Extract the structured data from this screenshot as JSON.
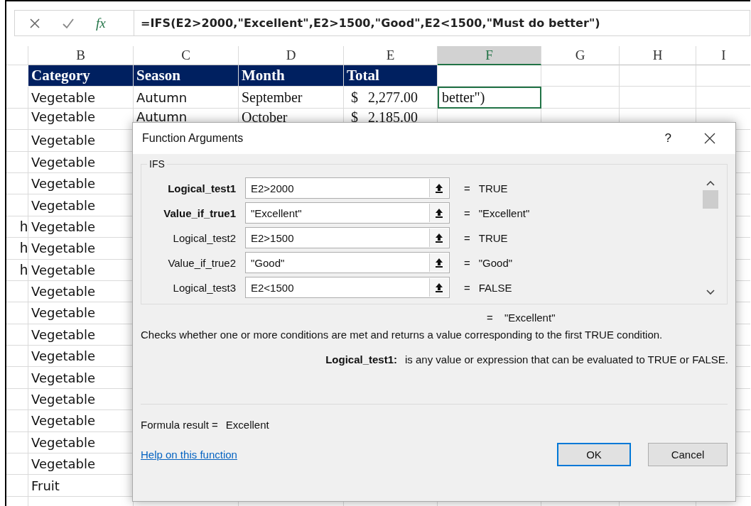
{
  "formula_bar": {
    "function_label": "fx",
    "formula": "=IFS(E2>2000,\"Excellent\",E2>1500,\"Good\",E2<1500,\"Must do better\")"
  },
  "columns": [
    {
      "label": "B",
      "selected": false
    },
    {
      "label": "C",
      "selected": false
    },
    {
      "label": "D",
      "selected": false
    },
    {
      "label": "E",
      "selected": false
    },
    {
      "label": "F",
      "selected": true
    },
    {
      "label": "G",
      "selected": false
    },
    {
      "label": "H",
      "selected": false
    },
    {
      "label": "I",
      "selected": false
    }
  ],
  "header_row": [
    "Category",
    "Season",
    "Month",
    "Total"
  ],
  "rows": [
    {
      "category": "Vegetable",
      "season": "Autumn",
      "month": "September",
      "currency": "$",
      "total": "2,277.00",
      "column_f": {
        "text": "better\")",
        "selected": true
      }
    },
    {
      "category": "Vegetable",
      "season": "Autumn",
      "month": "October",
      "currency": "$",
      "total": "2,185.00"
    },
    {
      "category": "Vegetable"
    },
    {
      "category": "Vegetable"
    },
    {
      "category": "Vegetable"
    },
    {
      "category": "Vegetable"
    },
    {
      "column_a": "h",
      "category": "Vegetable"
    },
    {
      "column_a": "h",
      "category": "Vegetable"
    },
    {
      "column_a": "h",
      "category": "Vegetable"
    },
    {
      "category": "Vegetable"
    },
    {
      "category": "Vegetable"
    },
    {
      "category": "Vegetable"
    },
    {
      "category": "Vegetable"
    },
    {
      "category": "Vegetable"
    },
    {
      "category": "Vegetable"
    },
    {
      "category": "Vegetable"
    },
    {
      "category": "Vegetable"
    },
    {
      "category": "Vegetable"
    },
    {
      "category": "Fruit"
    }
  ],
  "dialog": {
    "title": "Function Arguments",
    "help": "?",
    "function_name": "IFS",
    "arguments": [
      {
        "label": "Logical_test1",
        "bold": true,
        "value": "E2>2000",
        "equals": "=",
        "result": "TRUE"
      },
      {
        "label": "Value_if_true1",
        "bold": true,
        "value": "\"Excellent\"",
        "equals": "=",
        "result": "\"Excellent\""
      },
      {
        "label": "Logical_test2",
        "bold": false,
        "value": "E2>1500",
        "equals": "=",
        "result": "TRUE"
      },
      {
        "label": "Value_if_true2",
        "bold": false,
        "value": "\"Good\"",
        "equals": "=",
        "result": "\"Good\""
      },
      {
        "label": "Logical_test3",
        "bold": false,
        "value": "E2<1500",
        "equals": "=",
        "result": "FALSE"
      }
    ],
    "overall_equals": "=",
    "overall_result": "\"Excellent\"",
    "description": "Checks whether one or more conditions are met and returns a value corresponding to the first TRUE condition.",
    "argument_help": {
      "name": "Logical_test1:",
      "text": "is any value or expression that can be evaluated to TRUE or FALSE."
    },
    "formula_result_label": "Formula result =",
    "formula_result": "Excellent",
    "help_link": "Help on this function",
    "buttons": [
      {
        "label": "OK",
        "default": true
      },
      {
        "label": "Cancel",
        "default": false
      }
    ]
  }
}
